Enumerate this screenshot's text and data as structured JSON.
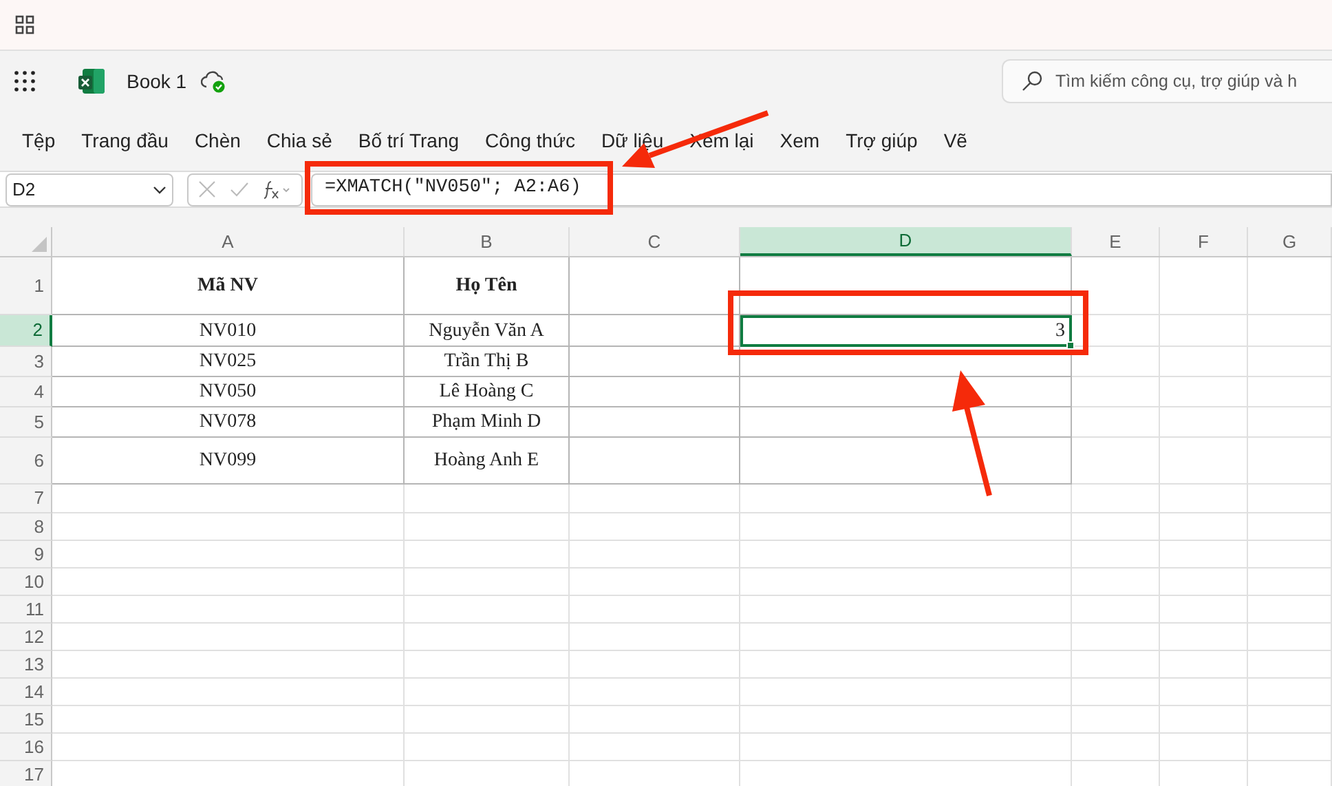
{
  "header": {
    "title": "Book 1",
    "search": {
      "placeholder": "Tìm kiếm công cụ, trợ giúp và h"
    }
  },
  "ribbon_tabs": [
    "Tệp",
    "Trang đầu",
    "Chèn",
    "Chia sẻ",
    "Bố trí Trang",
    "Công thức",
    "Dữ liệu",
    "Xem lại",
    "Xem",
    "Trợ giúp",
    "Vẽ"
  ],
  "formula_bar": {
    "name_box": "D2",
    "formula": "=XMATCH(\"NV050\"; A2:A6)"
  },
  "sheet": {
    "columns": [
      {
        "label": "A",
        "selected": false
      },
      {
        "label": "B",
        "selected": false
      },
      {
        "label": "C",
        "selected": false
      },
      {
        "label": "D",
        "selected": true
      },
      {
        "label": "E",
        "selected": false
      },
      {
        "label": "F",
        "selected": false
      },
      {
        "label": "G",
        "selected": false
      }
    ],
    "header_row": {
      "number": "1",
      "selected": false,
      "cells": [
        "Mã NV",
        "Họ Tên"
      ]
    },
    "rows": [
      {
        "number": "2",
        "selected": true,
        "cells": [
          "NV010",
          "Nguyễn Văn A"
        ],
        "active_cell": "3"
      },
      {
        "number": "3",
        "selected": false,
        "cells": [
          "NV025",
          "Trần Thị B"
        ]
      },
      {
        "number": "4",
        "selected": false,
        "cells": [
          "NV050",
          "Lê Hoàng C"
        ]
      },
      {
        "number": "5",
        "selected": false,
        "cells": [
          "NV078",
          "Phạm Minh D"
        ]
      },
      {
        "number": "6",
        "selected": false,
        "cells": [
          "NV099",
          "Hoàng Anh E"
        ]
      },
      {
        "number": "7",
        "selected": false
      },
      {
        "number": "8",
        "selected": false
      },
      {
        "number": "9",
        "selected": false
      },
      {
        "number": "10",
        "selected": false
      },
      {
        "number": "11",
        "selected": false
      },
      {
        "number": "12",
        "selected": false
      },
      {
        "number": "13",
        "selected": false
      },
      {
        "number": "14",
        "selected": false
      },
      {
        "number": "15",
        "selected": false
      },
      {
        "number": "16",
        "selected": false
      },
      {
        "number": "17",
        "selected": false
      }
    ]
  }
}
